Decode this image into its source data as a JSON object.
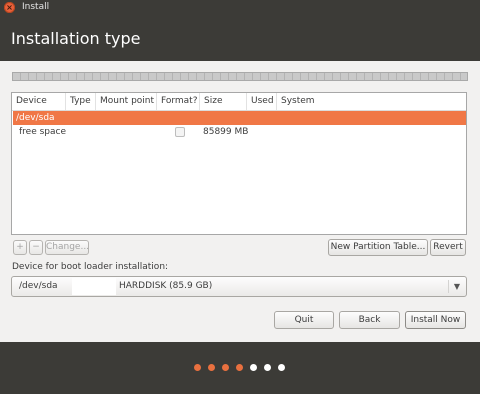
{
  "window": {
    "title": "Install",
    "close_icon": "close-icon",
    "close_glyph": "×"
  },
  "header": {
    "title": "Installation type"
  },
  "partition_table": {
    "columns": [
      "Device",
      "Type",
      "Mount point",
      "Format?",
      "Size",
      "Used",
      "System"
    ],
    "rows": [
      {
        "device": "/dev/sda",
        "type": "",
        "mount_point": "",
        "format": null,
        "size": "",
        "used": "",
        "system": "",
        "selected": true
      },
      {
        "device": "free space",
        "type": "",
        "mount_point": "",
        "format": false,
        "size": "85899 MB",
        "used": "",
        "system": "",
        "selected": false
      }
    ]
  },
  "table_buttons": {
    "add_label": "+",
    "remove_label": "−",
    "change_label": "Change...",
    "new_partition_table_label": "New Partition Table...",
    "revert_label": "Revert"
  },
  "boot_loader": {
    "label": "Device for boot loader installation:",
    "device": "/dev/sda",
    "model": "HARDDISK (85.9 GB)",
    "dropdown_glyph": "▼"
  },
  "actions": {
    "quit_label": "Quit",
    "back_label": "Back",
    "install_now_label": "Install Now"
  },
  "progress": {
    "total_steps": 7,
    "completed_steps": 4,
    "active_color": "#e9703f",
    "inactive_color": "#ffffff"
  },
  "colors": {
    "selection": "#f07746",
    "chrome": "#3c3b37"
  }
}
